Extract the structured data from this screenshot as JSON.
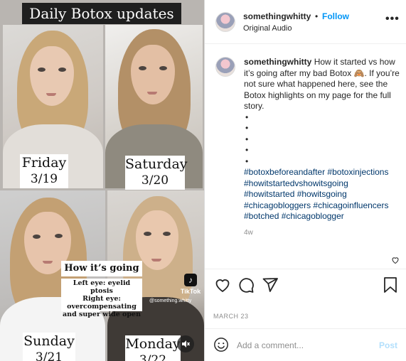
{
  "media": {
    "title": "Daily Botox updates",
    "days": [
      {
        "day": "Friday",
        "date": "3/19"
      },
      {
        "day": "Saturday",
        "date": "3/20"
      },
      {
        "day": "Sunday",
        "date": "3/21"
      },
      {
        "day": "Monday",
        "date": "3/22"
      }
    ],
    "note_heading": "How it’s going 🙈",
    "note_line1": "Left eye: eyelid ptosis",
    "note_line2": "Right eye:",
    "note_line3": "overcompensating",
    "note_line4": "and super wide open",
    "tiktok_label": "TikTok",
    "tiktok_handle": "@something.whitty",
    "tiktok_icon": "tiktok-logo-icon",
    "mute_icon": "speaker-muted-icon"
  },
  "header": {
    "username": "somethingwhitty",
    "separator": "•",
    "follow_label": "Follow",
    "audio_label": "Original Audio",
    "more_icon": "more-options-icon"
  },
  "caption": {
    "username": "somethingwhitty",
    "text": "How it started vs how it’s going after my bad Botox 🙈. If you’re not sure what happened here, see the Botox highlights on my page for the full story.",
    "dots": [
      "•",
      "•",
      "•",
      "•",
      "•"
    ],
    "hashtags": [
      "#botoxbeforeandafter #botoxinjections",
      "#howitstartedvshowitsgoing",
      "#howitstarted #howitsgoing",
      "#chicagobloggers #chicagoinfluencers",
      "#botched #chicagoblogger"
    ],
    "age": "4w"
  },
  "actions": {
    "like_icon": "heart-icon",
    "comment_icon": "comment-bubble-icon",
    "share_icon": "paper-plane-icon",
    "save_icon": "bookmark-icon"
  },
  "post_date": "MARCH 23",
  "comment_box": {
    "emoji_icon": "smiley-icon",
    "placeholder": "Add a comment...",
    "post_label": "Post"
  },
  "colors": {
    "link_blue": "#0095f6",
    "hashtag_blue": "#00376b",
    "post_disabled": "#b2dffc",
    "meta_gray": "#8e8e8e",
    "text": "#262626"
  }
}
